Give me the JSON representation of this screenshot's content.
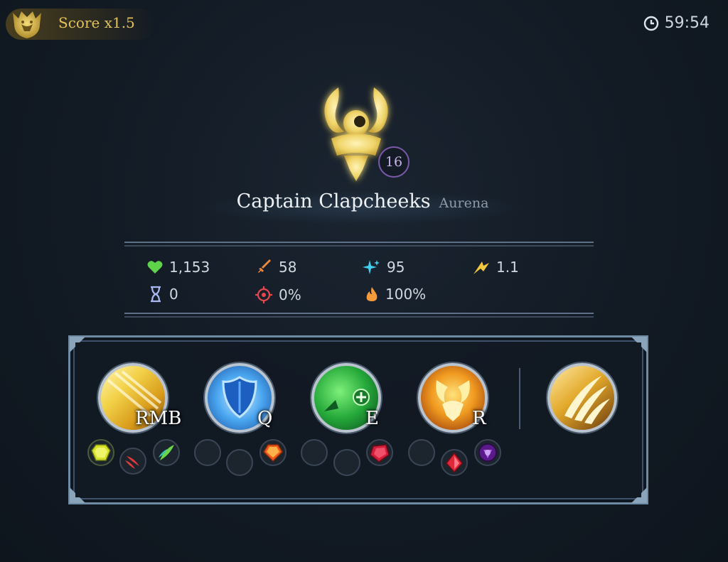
{
  "header": {
    "score_label": "Score x1.5",
    "timer": "59:54"
  },
  "hero": {
    "level": "16",
    "player_name": "Captain Clapcheeks",
    "hero_name": "Aurena"
  },
  "stats": {
    "health": "1,153",
    "power": "58",
    "ability_haste": "95",
    "attack_speed": "1.1",
    "cooldown_reduction": "0",
    "crit_chance": "0%",
    "burn": "100%"
  },
  "abilities": [
    {
      "key": "RMB",
      "icon": "light-slash-icon"
    },
    {
      "key": "Q",
      "icon": "blue-shield-icon"
    },
    {
      "key": "E",
      "icon": "green-heal-icon"
    },
    {
      "key": "R",
      "icon": "flame-crest-icon"
    },
    {
      "key": "",
      "icon": "golden-claw-icon"
    }
  ],
  "colors": {
    "gold": "#e6c25a",
    "accent_purple": "#7a5aa8",
    "panel_border": "#6f8aa3"
  }
}
